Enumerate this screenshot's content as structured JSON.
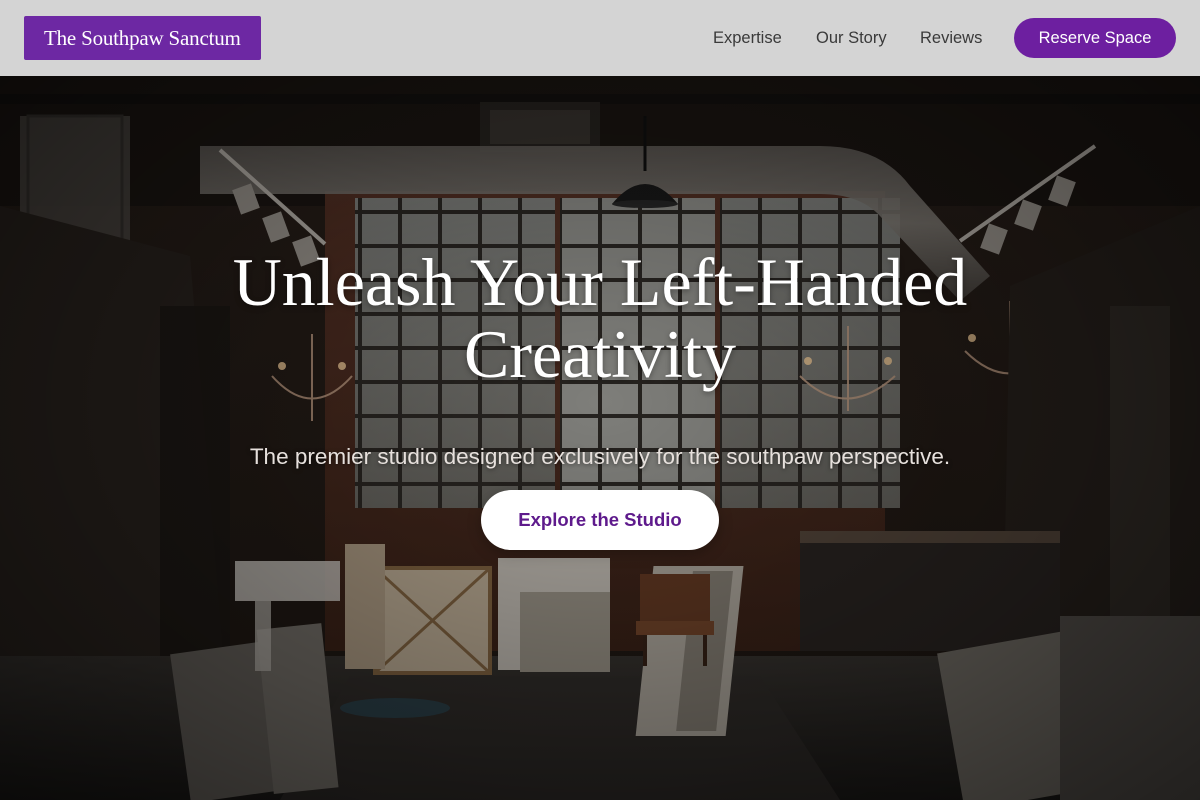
{
  "brand": {
    "name": "The Southpaw Sanctum"
  },
  "nav": {
    "links": [
      {
        "label": "Expertise"
      },
      {
        "label": "Our Story"
      },
      {
        "label": "Reviews"
      }
    ],
    "cta_label": "Reserve Space"
  },
  "hero": {
    "title_line1": "Unleash Your Left-Handed",
    "title_line2": "Creativity",
    "subtitle": "The premier studio designed exclusively for the southpaw perspective.",
    "cta_label": "Explore the Studio"
  },
  "colors": {
    "brand_purple": "#6d28a3",
    "nav_background": "#d4d4d4",
    "cta_text": "#5e1a8c"
  }
}
